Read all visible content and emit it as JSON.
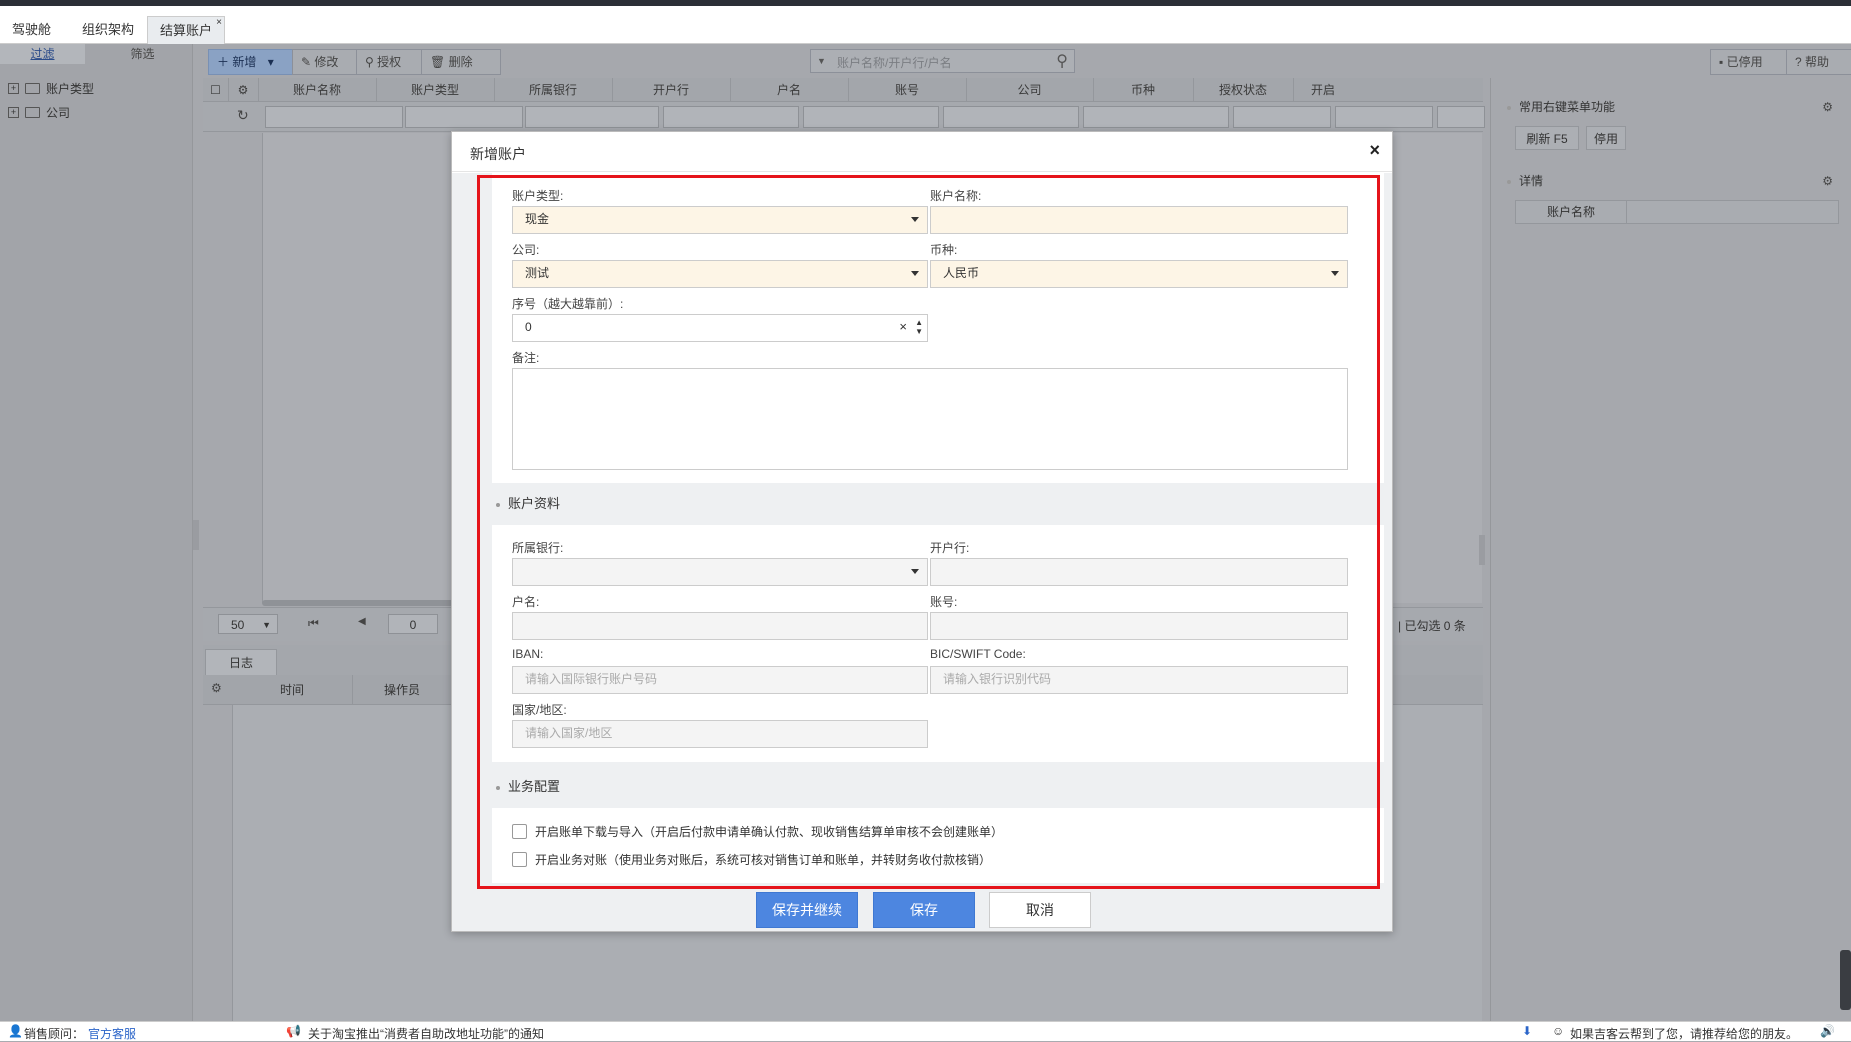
{
  "tabs": [
    {
      "label": "驾驶舱"
    },
    {
      "label": "组织架构"
    },
    {
      "label": "结算账户",
      "close": "×"
    }
  ],
  "left_panel": {
    "tab_filter": "过滤",
    "tab_select": "筛选",
    "tree": [
      "账户类型",
      "公司"
    ]
  },
  "toolbar": {
    "add": "新增",
    "edit": "修改",
    "auth": "授权",
    "delete": "删除",
    "search_placeholder": "账户名称/开户行/户名",
    "disabled": "已停用",
    "help": "帮助"
  },
  "grid": {
    "columns": [
      "账户名称",
      "账户类型",
      "所属银行",
      "开户行",
      "户名",
      "账号",
      "公司",
      "币种",
      "授权状态",
      "开启"
    ]
  },
  "pager": {
    "page_size": "50",
    "page": "0",
    "selected": "| 已勾选 0 条"
  },
  "log": {
    "tab": "日志",
    "columns": [
      "时间",
      "操作员"
    ]
  },
  "right_panel": {
    "menu_title": "常用右键菜单功能",
    "refresh": "刷新  F5",
    "disable": "停用",
    "detail_title": "详情",
    "detail_col": "账户名称"
  },
  "dialog": {
    "title": "新增账户",
    "close": "×",
    "basic": {
      "account_type_label": "账户类型:",
      "account_type_value": "现金",
      "account_name_label": "账户名称:",
      "account_name_value": "",
      "company_label": "公司:",
      "company_value": "测试",
      "currency_label": "币种:",
      "currency_value": "人民币",
      "order_label": "序号（越大越靠前）:",
      "order_value": "0",
      "remark_label": "备注:"
    },
    "account_info": {
      "title": "账户资料",
      "bank_label": "所属银行:",
      "branch_label": "开户行:",
      "holder_label": "户名:",
      "number_label": "账号:",
      "iban_label": "IBAN:",
      "iban_placeholder": "请输入国际银行账户号码",
      "swift_label": "BIC/SWIFT Code:",
      "swift_placeholder": "请输入银行识别代码",
      "country_label": "国家/地区:",
      "country_placeholder": "请输入国家/地区"
    },
    "business": {
      "title": "业务配置",
      "option1": "开启账单下载与导入（开启后付款申请单确认付款、现收销售结算单审核不会创建账单）",
      "option2": "开启业务对账（使用业务对账后，系统可核对销售订单和账单，并转财务收付款核销）"
    },
    "buttons": {
      "save_continue": "保存并继续",
      "save": "保存",
      "cancel": "取消"
    }
  },
  "bottom": {
    "advisor_label": "销售顾问：",
    "advisor_link": "官方客服",
    "notice": "关于淘宝推出“消费者自助改地址功能”的通知",
    "share": "如果吉客云帮到了您，请推荐给您的朋友。"
  }
}
